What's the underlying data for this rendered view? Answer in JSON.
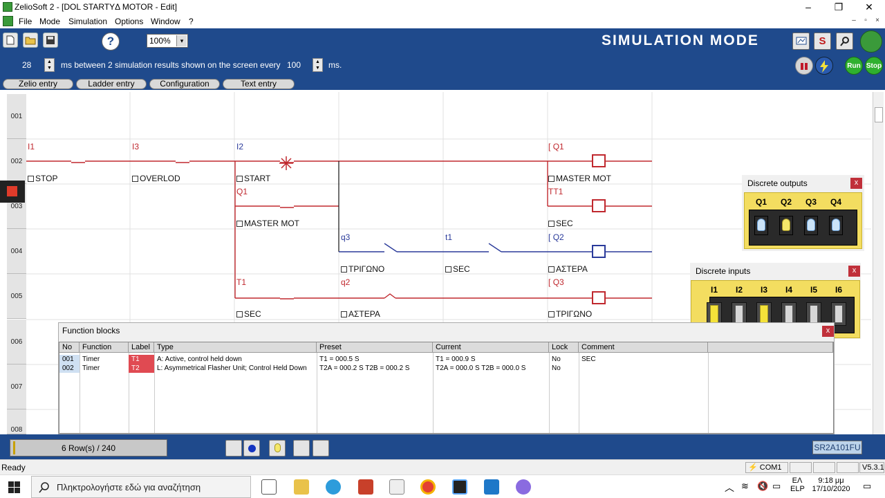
{
  "window": {
    "title": "ZelioSoft 2 - [DOL STARTYΔ MOTOR - Edit]",
    "minimize": "–",
    "maximize": "❐",
    "close": "✕"
  },
  "menu": [
    "File",
    "Mode",
    "Simulation",
    "Options",
    "Window",
    "?"
  ],
  "mdi_controls": [
    "–",
    "▫",
    "×"
  ],
  "toolbar": {
    "zoom": "100%",
    "help": "?",
    "mode_title": "SIMULATION MODE",
    "s_label": "S",
    "zoom_dropdown_arrow": "▾"
  },
  "sim": {
    "step_value": "28",
    "interval_text": "ms between 2 simulation results shown on the screen every",
    "refresh_value": "100",
    "unit": "ms.",
    "run_label": "Run",
    "stop_label": "Stop",
    "spin_up": "▲",
    "spin_down": "▼"
  },
  "tabs": [
    "Zelio entry",
    "Ladder entry",
    "Configuration",
    "Text entry"
  ],
  "rows": [
    "001",
    "002",
    "003",
    "004",
    "005",
    "006",
    "007",
    "008"
  ],
  "ladder": {
    "r2": {
      "c1_addr": "I1",
      "c1_name": "STOP",
      "c2_addr": "I3",
      "c2_name": "OVERLOD",
      "c3_addr": "I2",
      "c3_name": "START",
      "coil_addr": "Q1",
      "coil_name": "MASTER MOT",
      "coil_prefix": "["
    },
    "r3": {
      "c_addr": "Q1",
      "c_name": "MASTER MOT",
      "coil_addr": "TT1",
      "coil_name": "SEC"
    },
    "r4": {
      "c1_addr": "q3",
      "c1_name": "ΤΡΙΓΩΝΟ",
      "c2_addr": "t1",
      "c2_name": "SEC",
      "coil_addr": "Q2",
      "coil_name": "ΑΣΤΕΡΑ",
      "coil_prefix": "["
    },
    "r5": {
      "c1_addr": "T1",
      "c1_name": "SEC",
      "c2_addr": "q2",
      "c2_name": "ΑΣΤΕΡΑ",
      "coil_addr": "Q3",
      "coil_name": "ΤΡΙΓΩΝΟ",
      "coil_prefix": "["
    }
  },
  "discrete_outputs": {
    "title": "Discrete outputs",
    "close": "x",
    "labels": [
      "Q1",
      "Q2",
      "Q3",
      "Q4"
    ],
    "states": [
      false,
      true,
      false,
      false
    ]
  },
  "discrete_inputs": {
    "title": "Discrete inputs",
    "close": "x",
    "labels": [
      "I1",
      "I2",
      "I3",
      "I4",
      "I5",
      "I6"
    ],
    "states": [
      true,
      false,
      true,
      false,
      false,
      false
    ]
  },
  "function_blocks": {
    "title": "Function blocks",
    "close": "x",
    "headers": [
      "No",
      "Function",
      "Label",
      "Type",
      "Preset",
      "Current",
      "Lock",
      "Comment"
    ],
    "rows": [
      {
        "no": "001",
        "function": "Timer",
        "label": "T1",
        "type": "A: Active, control held down",
        "preset": "T1 = 000.5 S",
        "current": "T1 = 000.9 S",
        "lock": "No",
        "comment": "SEC"
      },
      {
        "no": "002",
        "function": "Timer",
        "label": "T2",
        "type": "L: Asymmetrical Flasher Unit; Control Held Down",
        "preset": "T2A = 000.2 S  T2B = 000.2 S",
        "current": "T2A = 000.0 S  T2B = 000.0 S",
        "lock": "No",
        "comment": ""
      }
    ]
  },
  "status": {
    "rows": "6 Row(s) / 240",
    "model": "SR2A101FU"
  },
  "statusbar": {
    "ready": "Ready",
    "com": "COM1",
    "version": "V5.3.1"
  },
  "taskbar": {
    "search_placeholder": "Πληκτρολογήστε εδώ για αναζήτηση",
    "lang_top": "ΕΛ",
    "lang_bottom": "ELP",
    "time": "9:18 μμ",
    "date": "17/10/2020"
  }
}
